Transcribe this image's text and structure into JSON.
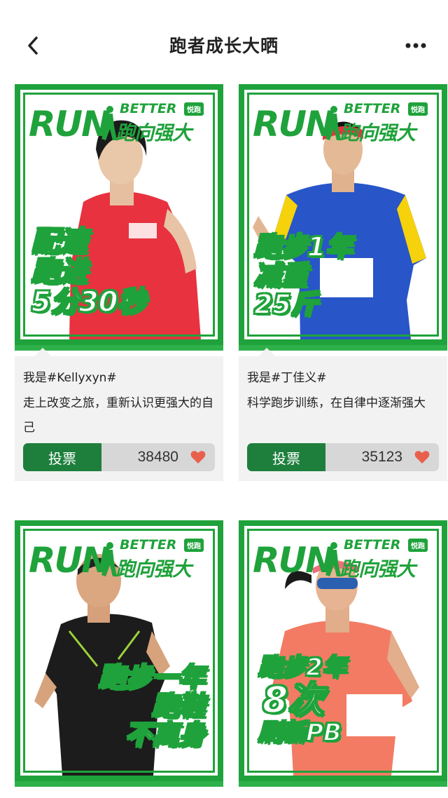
{
  "header": {
    "title": "跑者成长大晒",
    "back_icon": "chevron-left-icon",
    "more_icon": "more-dots-icon"
  },
  "brand": {
    "run": "RUN",
    "better": "BETTER",
    "badge": "悦跑",
    "slogan_cn": "跑向强大",
    "color": "#1fa23b"
  },
  "cards": [
    {
      "slogan": [
        "配速",
        "跑进",
        "5分30秒"
      ],
      "user_tag": "我是#Kellyxyn#",
      "description": "走上改变之旅，重新认识更强大的自己",
      "vote_label": "投票",
      "votes": "38480"
    },
    {
      "slogan": [
        "跑步1年",
        "减重",
        "25斤"
      ],
      "user_tag": "我是#丁佳义#",
      "description": "科学跑步训练，在自律中逐渐强大",
      "vote_label": "投票",
      "votes": "35123"
    },
    {
      "slogan": [
        "跑步一年",
        "跑鞋",
        "不离身"
      ]
    },
    {
      "slogan": [
        "跑步2年",
        "8次",
        "刷新PB"
      ]
    }
  ],
  "colors": {
    "accent_green": "#1fa23b",
    "vote_button": "#1e7f3d",
    "heart": "#e8604c"
  }
}
